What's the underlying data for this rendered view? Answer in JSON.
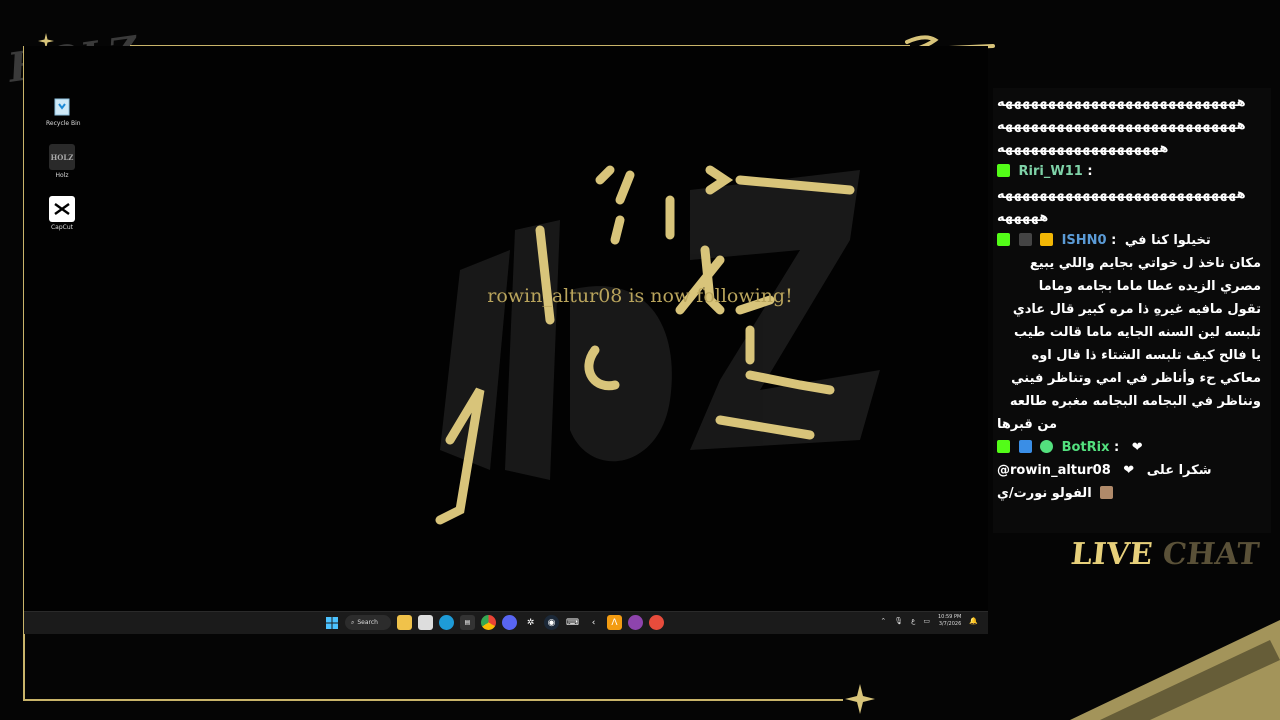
{
  "corner_logo": "HOLZ",
  "desktop_icons": [
    {
      "label": "Recycle Bin",
      "icon": "recycle-bin-icon"
    },
    {
      "label": "Holz",
      "icon": "holz-app-icon"
    },
    {
      "label": "CapCut",
      "icon": "capcut-icon"
    }
  ],
  "notification": {
    "text": "rowin_altur08 is now following!"
  },
  "taskbar": {
    "search_label": "Search",
    "time": "10:59 PM",
    "date": "3/7/2026",
    "lang": "ع"
  },
  "chat": {
    "messages_lines": [
      "ههههههههههههههههههههههههههههه",
      "ههههههههههههههههههههههههههههه",
      "هههههههههههههههههههه"
    ],
    "msg2": {
      "user": "Riri_W11",
      "sep": ":",
      "text_lines": [
        "ههههههههههههههههههههههههههههه",
        "هههههه"
      ]
    },
    "msg3": {
      "user": "ISHN0",
      "sep": ":",
      "text_lines": [
        "تخيلوا كنا في",
        "مكان ناخذ ل خواتي بجايم واللي يبيع",
        "مصري الزيده عطا ماما بجامه وماما",
        "تقول مافيه غيرهِ ذا مره كبير قال عادي",
        "تلبسه لين السنه الجايه ماما قالت طيب",
        "يا فالح كيف تلبسه الشتاء ذا قال اوه",
        "معاكي حء وأناظر في امي وتناظر فيني",
        "ونناظر في البجامه البجامه مغبره طالعه",
        "من قبرها"
      ]
    },
    "msg4": {
      "user": "BotRix",
      "sep": ":",
      "heart": "❤",
      "text_lines": [
        "شكرا على",
        "@rowin_altur08",
        "الفولو نورت/ي"
      ]
    },
    "live_label": "LIVE",
    "chat_label": "CHAT"
  },
  "colors": {
    "accent_gold": "#c9b46a",
    "kick_green": "#53fc18",
    "chat_bg": "#0a0a0a"
  }
}
